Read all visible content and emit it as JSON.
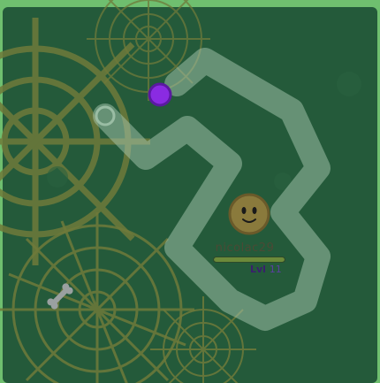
{
  "game": {
    "colors": {
      "background": "#245a3a",
      "border": "#6fbf6f",
      "web": "#6f7a3a",
      "trail": "#a8c8b0",
      "orb": "#8a2be2",
      "player": "#8a7a3c"
    },
    "player": {
      "name": "nicolac29",
      "level_label": "Lvl",
      "level": "11",
      "xp_fraction": 1.0
    },
    "orb": {
      "type": "purple-orb"
    },
    "pickup": {
      "type": "bone-icon"
    },
    "hazards": {
      "type": "spider-web"
    }
  }
}
